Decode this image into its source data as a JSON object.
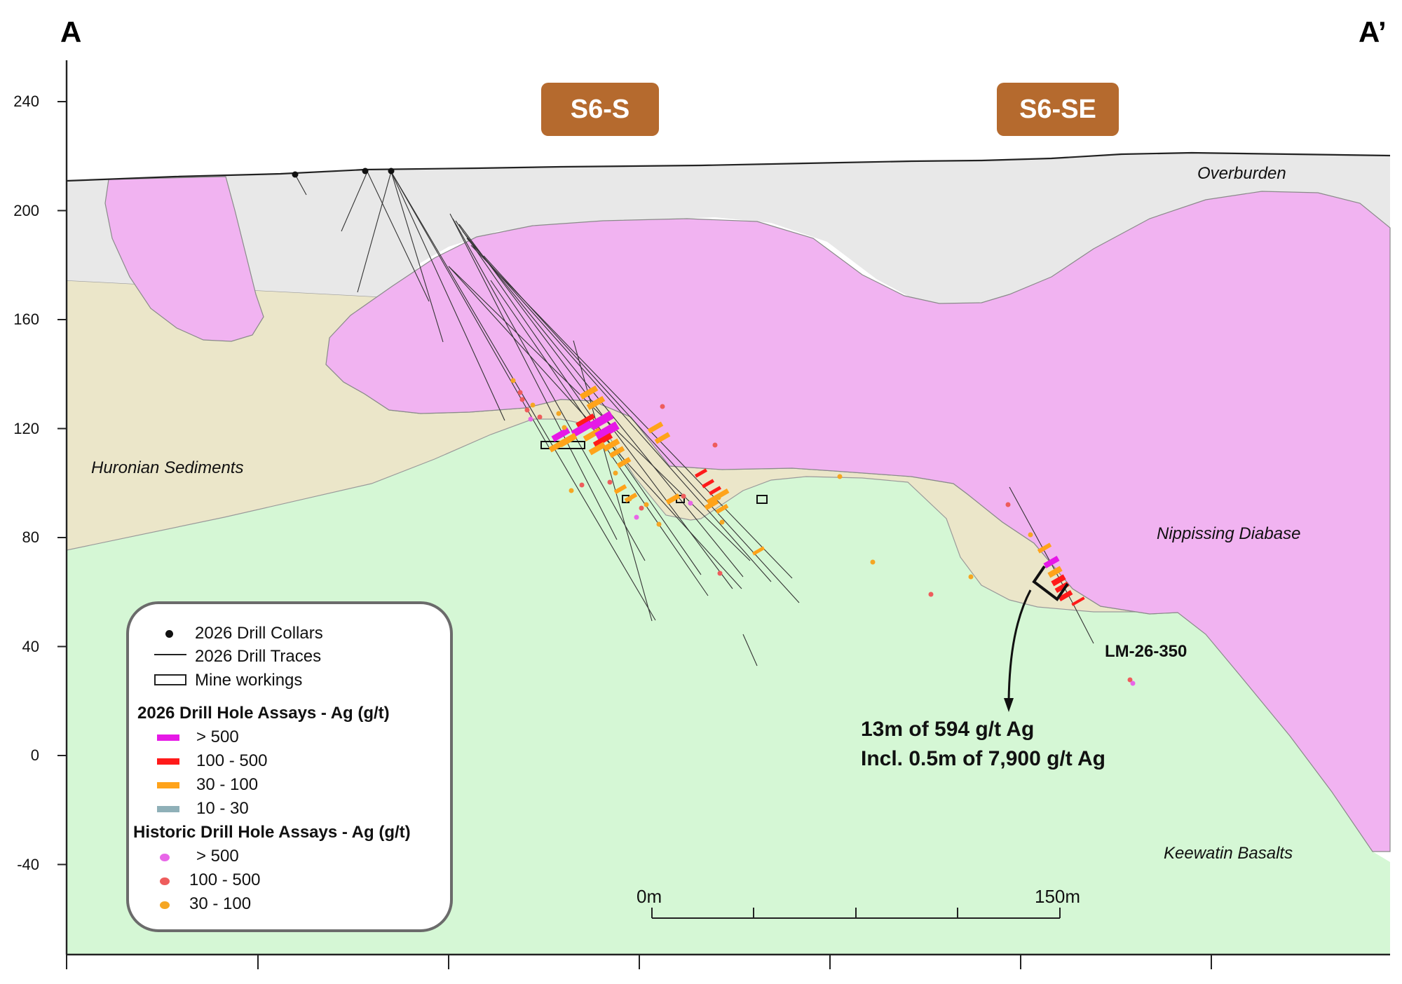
{
  "section": {
    "start_label": "A",
    "end_label": "A’"
  },
  "y_axis": {
    "ticks": [
      "240",
      "200",
      "160",
      "120",
      "80",
      "40",
      "0",
      "-40"
    ]
  },
  "zones": [
    {
      "label": "S6-S",
      "color": "#b56a2e"
    },
    {
      "label": "S6-SE",
      "color": "#b56a2e"
    }
  ],
  "units": [
    {
      "name": "Overburden",
      "color": "#e8e8e8"
    },
    {
      "name": "Huronian Sediments",
      "color": "#ebe6c9"
    },
    {
      "name": "Nippissing Diabase",
      "color": "#f1b3f1"
    },
    {
      "name": "Keewatin Basalts",
      "color": "#d5f7d5"
    }
  ],
  "hole_label": "LM-26-350",
  "highlight": {
    "line1": "13m of 594 g/t Ag",
    "line2": "Incl. 0.5m of 7,900 g/t Ag"
  },
  "scale_bar": {
    "start": "0m",
    "end": "150m"
  },
  "legend": {
    "collars": "2026 Drill Collars",
    "traces": "2026 Drill Traces",
    "workings": "Mine workings",
    "assays_2026_title": "2026 Drill Hole Assays - Ag (g/t)",
    "assays_2026": [
      {
        "label": "> 500",
        "color": "#e619e6"
      },
      {
        "label": "100 - 500",
        "color": "#ff1a1a"
      },
      {
        "label": "30 - 100",
        "color": "#ffa31a"
      },
      {
        "label": "10 - 30",
        "color": "#8fb0b8"
      }
    ],
    "historic_title": "Historic Drill Hole Assays - Ag (g/t)",
    "historic": [
      {
        "label": "> 500",
        "color": "#e866e8"
      },
      {
        "label": "100 - 500",
        "color": "#ee5c5c"
      },
      {
        "label": "30 - 100",
        "color": "#f5a623"
      }
    ]
  }
}
